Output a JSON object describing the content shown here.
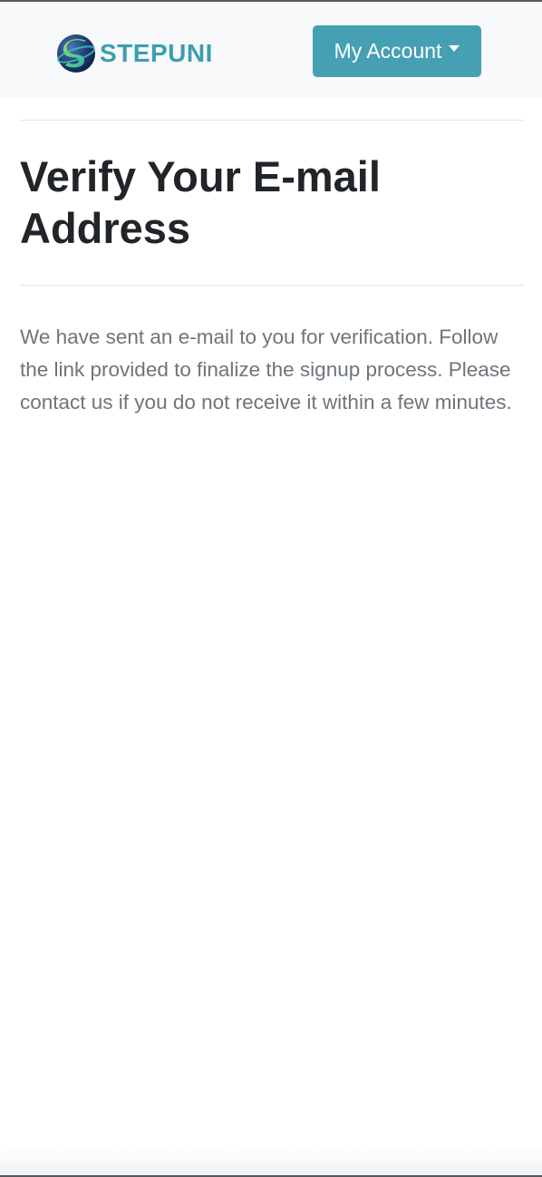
{
  "brand": {
    "name": "STEPUNI",
    "color": "#3d9db1"
  },
  "header": {
    "account_label": "My Account"
  },
  "main": {
    "title": "Verify Your E-mail Address",
    "message": "We have sent an e-mail to you for verification. Follow the link provided to finalize the signup process. Please contact us if you do not receive it within a few minutes."
  },
  "colors": {
    "accent": "#45a0b3",
    "navbar_bg": "#f8f9fa",
    "title": "#212529",
    "text_muted": "#6c757d"
  },
  "icons": {
    "logo": "stepuni-logo-icon",
    "dropdown": "caret-down-icon"
  }
}
